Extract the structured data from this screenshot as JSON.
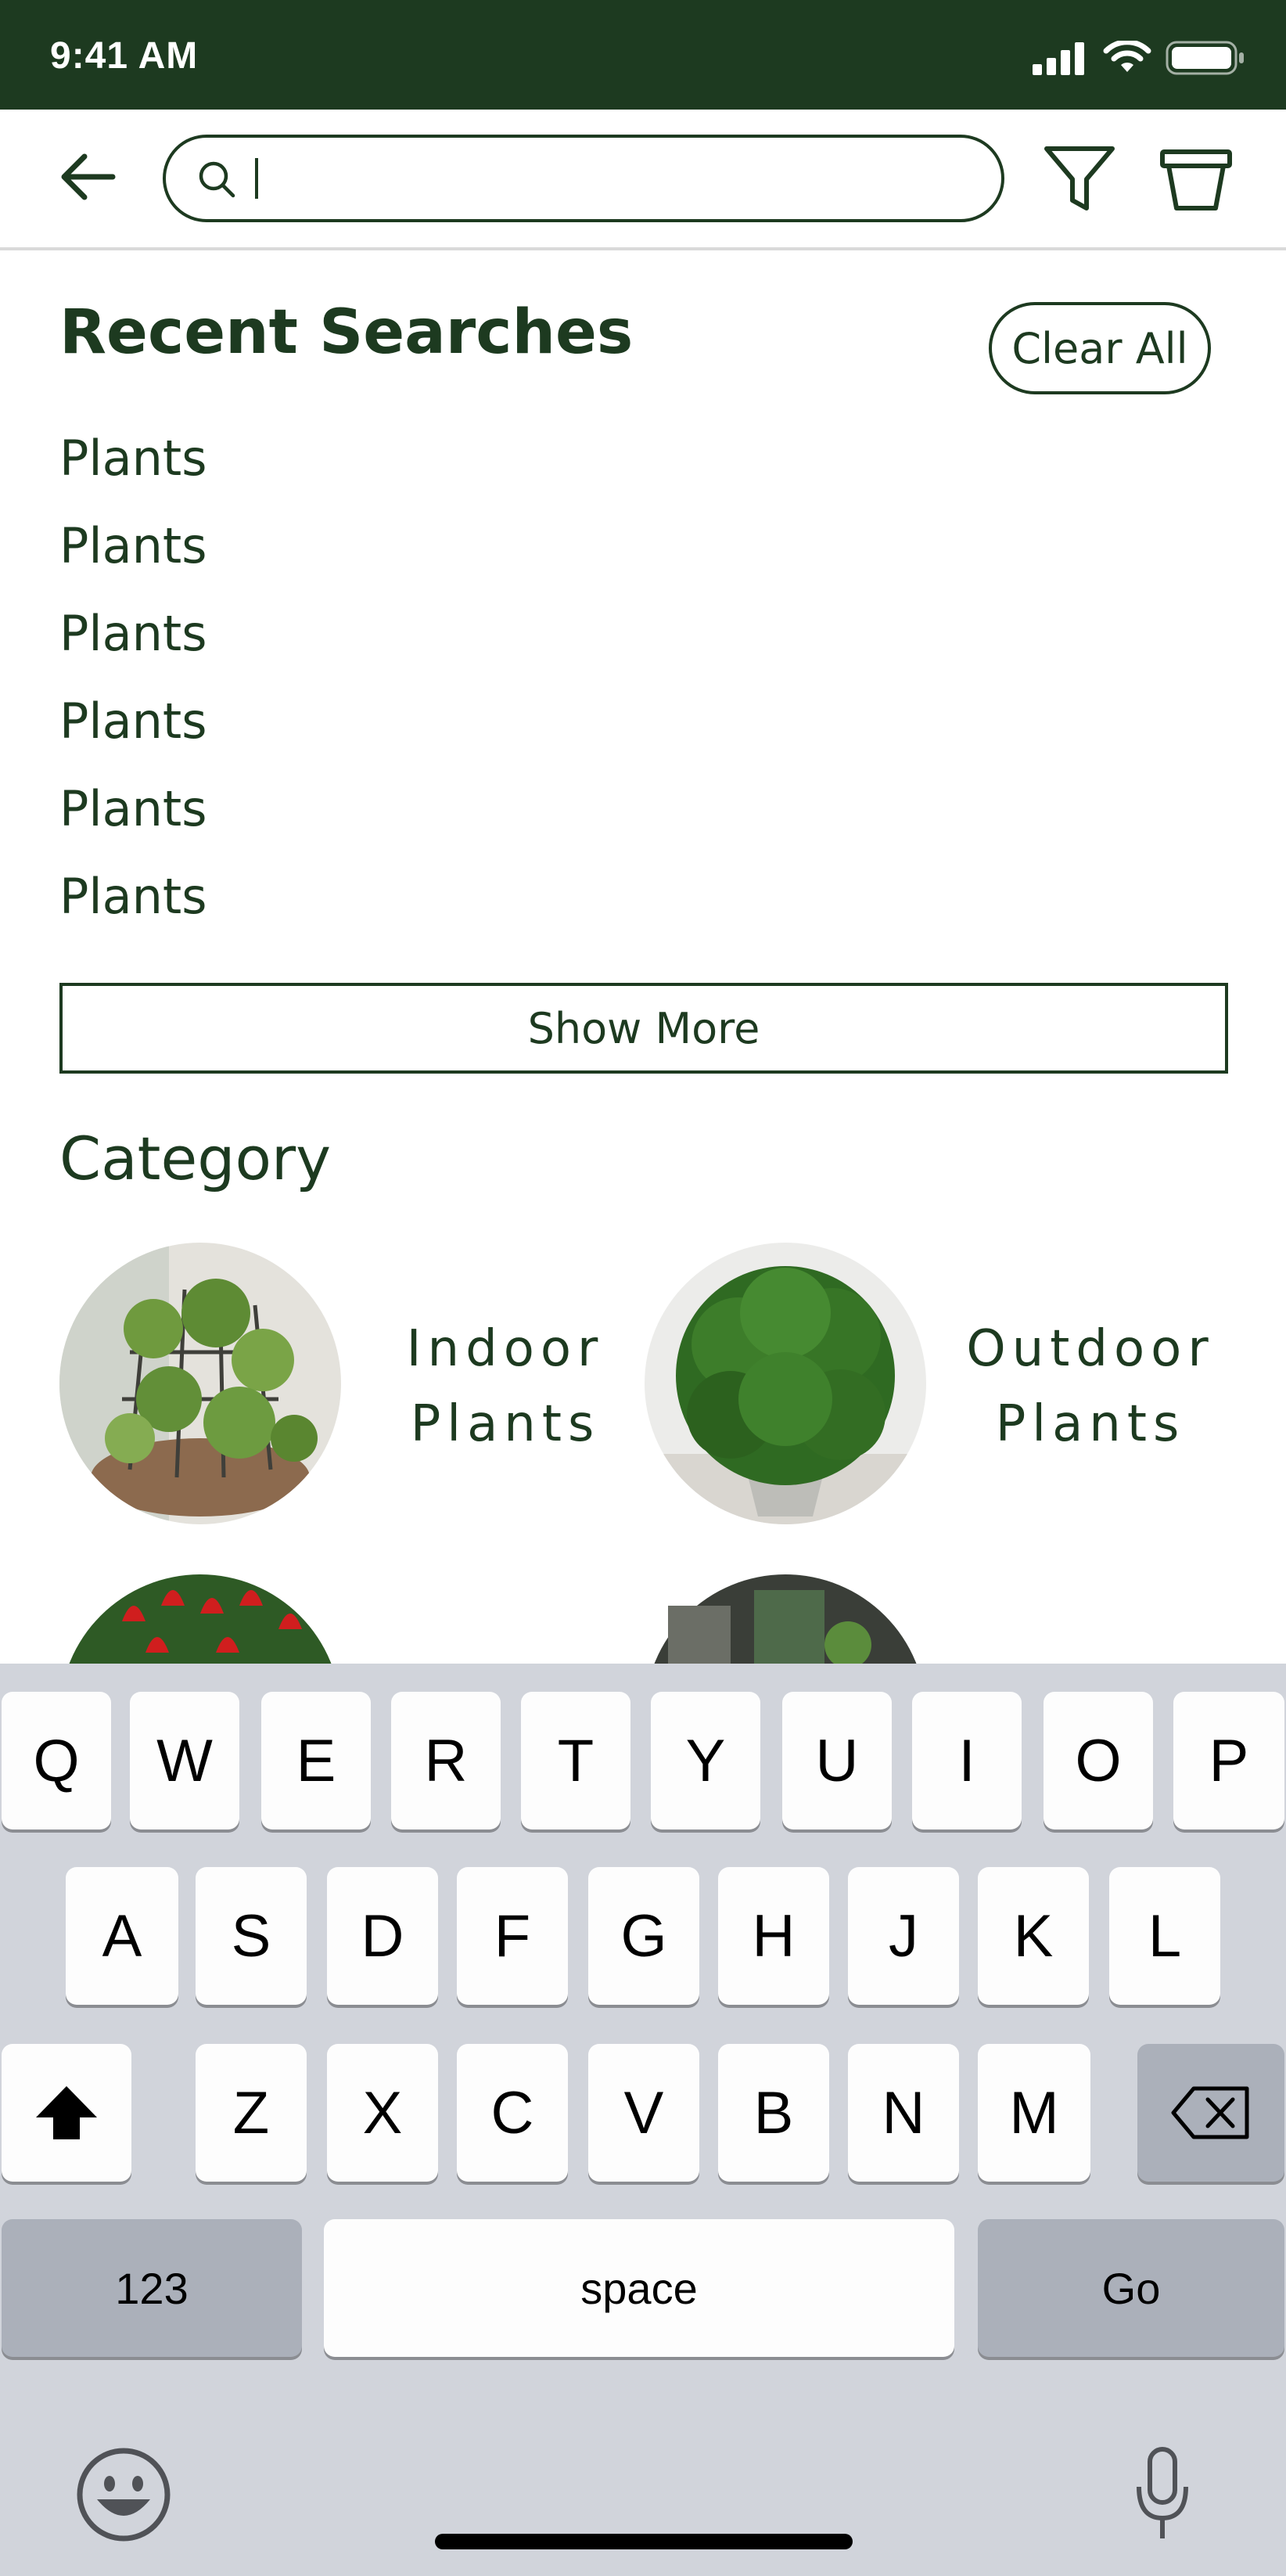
{
  "status_bar": {
    "time": "9:41 AM"
  },
  "header": {
    "back_icon": "arrow-left-icon",
    "search": {
      "value": "",
      "placeholder": ""
    },
    "filter_icon": "filter-icon",
    "bag_icon": "basket-icon"
  },
  "recent": {
    "title": "Recent Searches",
    "clear_label": "Clear All",
    "items": [
      "Plants",
      "Plants",
      "Plants",
      "Plants",
      "Plants",
      "Plants"
    ],
    "show_more_label": "Show More"
  },
  "category": {
    "title": "Category",
    "items": [
      {
        "line1": "Indoor",
        "line2": "Plants"
      },
      {
        "line1": "Outdoor",
        "line2": "Plants"
      }
    ]
  },
  "keyboard": {
    "row1": [
      "Q",
      "W",
      "E",
      "R",
      "T",
      "Y",
      "U",
      "I",
      "O",
      "P"
    ],
    "row2": [
      "A",
      "S",
      "D",
      "F",
      "G",
      "H",
      "J",
      "K",
      "L"
    ],
    "row3": [
      "Z",
      "X",
      "C",
      "V",
      "B",
      "N",
      "M"
    ],
    "numbers_label": "123",
    "space_label": "space",
    "go_label": "Go"
  },
  "colors": {
    "primary": "#1d3a20",
    "keyboard_bg": "#d1d4db",
    "key": "#fdfdfd",
    "key_dark": "#abb0ba"
  }
}
